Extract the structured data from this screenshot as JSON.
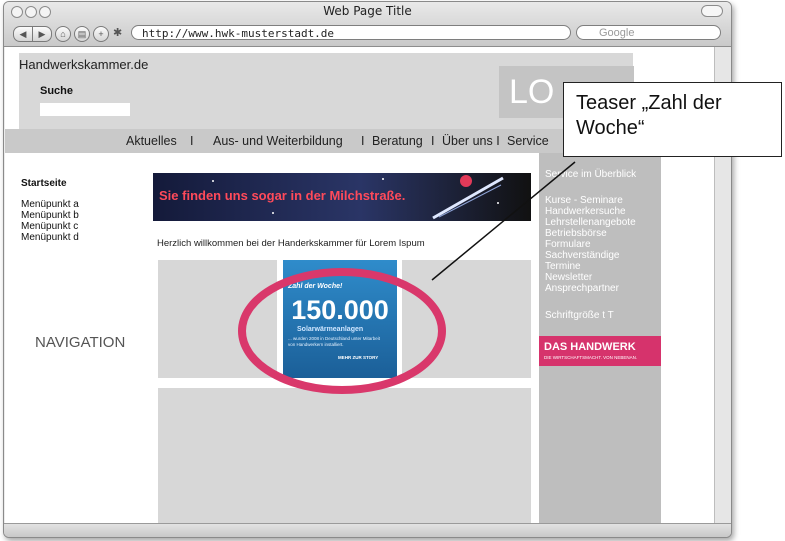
{
  "browser": {
    "window_title": "Web Page Title",
    "url": "http://www.hwk-musterstadt.de",
    "search_placeholder": "Google"
  },
  "site": {
    "name": "Handwerkskammer.de",
    "search_label": "Suche",
    "logo_text": "LO",
    "menu": [
      "Aktuelles",
      "I",
      "Aus- und Weiterbildung",
      "I",
      "Beratung",
      "I",
      "Über uns I",
      "Service"
    ],
    "left_nav": {
      "title": "Startseite",
      "items": [
        "Menüpunkt a",
        "Menüpunkt b",
        "Menüpunkt c",
        "Menüpunkt d"
      ],
      "label": "NAVIGATION"
    },
    "banner_text": "Sie finden uns sogar in der Milchstraße.",
    "welcome": "Herzlich willkommen bei der Handerkskammer für Lorem Ispum",
    "teaser": {
      "heading": "Zahl der Woche!",
      "number": "150.000",
      "subtitle": "Solarwärmeanlagen",
      "body": "... wurden 2008 in Deutschland unter Mitarbeit von Handwerkern installiert.",
      "link": "MEHR ZUR STORY"
    },
    "right_links": [
      "Service im Überblick",
      "Kurse - Seminare",
      "Handwerkersuche",
      "Lehrstellenangebote",
      "Betriebsbörse",
      "Formulare",
      "Sachverständige",
      "Termine",
      "Newsletter",
      "Ansprechpartner"
    ],
    "font_size_label": "Schriftgröße t T",
    "badge": {
      "title": "DAS HANDWERK",
      "subtitle": "DIE WIRTSCHAFTSMACHT. VON NEBENAN."
    }
  },
  "annotation": {
    "callout_text": "Teaser „Zahl der Woche“"
  },
  "colors": {
    "highlight_ellipse": "#d9386b",
    "teaser_blue": "#1f7ab8",
    "badge_pink": "#d6336c",
    "banner_dark": "#1a1e3a",
    "banner_text": "#ff4a5a"
  }
}
